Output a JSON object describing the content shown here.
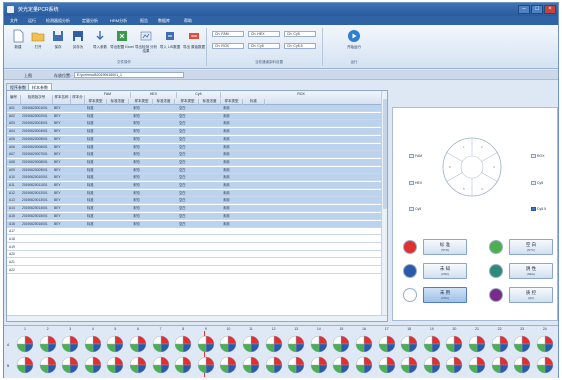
{
  "window": {
    "title": "荧光定量PCR系统"
  },
  "menu": [
    "文件",
    "运行",
    "检测器组分析",
    "定量分析",
    "HRM分析",
    "报告",
    "数据库",
    "帮助"
  ],
  "ribbon": {
    "buttons": [
      {
        "label": "新建",
        "icon": "new-file-icon"
      },
      {
        "label": "打开",
        "icon": "open-folder-icon"
      },
      {
        "label": "保存",
        "icon": "save-icon"
      },
      {
        "label": "另存为",
        "icon": "save-as-icon"
      },
      {
        "label": "导入参数",
        "icon": "import-params-icon"
      },
      {
        "label": "导出配置 Excel",
        "icon": "export-excel-icon"
      },
      {
        "label": "导出检测 分析结果",
        "icon": "export-results-icon"
      },
      {
        "label": "导入 LIS数据",
        "icon": "import-lis-icon"
      },
      {
        "label": "导出 原始数据",
        "icon": "export-raw-icon"
      },
      {
        "label": "开始运行",
        "icon": "run-icon"
      }
    ],
    "groups": [
      {
        "label": "文件操作"
      },
      {
        "label": "当前通道染料设置"
      },
      {
        "label": "运行"
      }
    ],
    "fields": [
      "Ch: FAM",
      "Ch: HEX",
      "Ch: Cy5",
      "Ch: ROX",
      "Ch: Cy5",
      "Ch: Cy5.5"
    ]
  },
  "pathbar": {
    "left_label": "上图",
    "path_label": "存放位置:",
    "path_value": "E:\\pcr\\result\\20190616001_1"
  },
  "tabs": [
    "程序参数",
    "样本参数"
  ],
  "table": {
    "headers_top": [
      "编号",
      "检测批次号",
      "样本名称",
      "样本分",
      "FAM",
      "HEX",
      "Cy5",
      "ROX"
    ],
    "headers_sub": [
      "样本类型",
      "标准浓度",
      "样本类型",
      "标准浓度",
      "样本类型",
      "标准浓度",
      "样本类型",
      "标准"
    ],
    "rows": [
      [
        "A01",
        "20190620001001",
        "BEY",
        "",
        "标准",
        "",
        "未知",
        "",
        "空白",
        "",
        "未用"
      ],
      [
        "A02",
        "20190620002001",
        "BEY",
        "",
        "标准",
        "",
        "未知",
        "",
        "空白",
        "",
        "未用"
      ],
      [
        "A03",
        "20190620003001",
        "BEY",
        "",
        "标准",
        "",
        "未知",
        "",
        "空白",
        "",
        "未用"
      ],
      [
        "A04",
        "20190620004001",
        "BEY",
        "",
        "标准",
        "",
        "未知",
        "",
        "空白",
        "",
        "未用"
      ],
      [
        "A05",
        "20190620005001",
        "BEY",
        "",
        "标准",
        "",
        "未知",
        "",
        "空白",
        "",
        "未用"
      ],
      [
        "A06",
        "20190620006001",
        "BEY",
        "",
        "标准",
        "",
        "未知",
        "",
        "空白",
        "",
        "未用"
      ],
      [
        "A07",
        "20190620007001",
        "BEY",
        "",
        "标准",
        "",
        "未知",
        "",
        "空白",
        "",
        "未用"
      ],
      [
        "A08",
        "20190620008001",
        "BEY",
        "",
        "标准",
        "",
        "未知",
        "",
        "空白",
        "",
        "未用"
      ],
      [
        "A09",
        "20190620009001",
        "BEY",
        "",
        "标准",
        "",
        "未知",
        "",
        "空白",
        "",
        "未用"
      ],
      [
        "A10",
        "20190620010001",
        "BEY",
        "",
        "标准",
        "",
        "未知",
        "",
        "空白",
        "",
        "未用"
      ],
      [
        "A11",
        "20190620011001",
        "BEY",
        "",
        "标准",
        "",
        "未知",
        "",
        "空白",
        "",
        "未用"
      ],
      [
        "A12",
        "20190620012001",
        "BEY",
        "",
        "标准",
        "",
        "未知",
        "",
        "空白",
        "",
        "未用"
      ],
      [
        "A13",
        "20190620013001",
        "BEY",
        "",
        "标准",
        "",
        "未知",
        "",
        "空白",
        "",
        "未用"
      ],
      [
        "A14",
        "20190620014001",
        "BEY",
        "",
        "标准",
        "",
        "未知",
        "",
        "空白",
        "",
        "未用"
      ],
      [
        "A15",
        "20190620015001",
        "BEY",
        "",
        "标准",
        "",
        "未知",
        "",
        "空白",
        "",
        "未用"
      ],
      [
        "A16",
        "20190620016001",
        "BEY",
        "",
        "标准",
        "",
        "未知",
        "",
        "空白",
        "",
        "未用"
      ],
      [
        "A17",
        "",
        "",
        "",
        "",
        "",
        "",
        "",
        "",
        "",
        ""
      ],
      [
        "A18",
        "",
        "",
        "",
        "",
        "",
        "",
        "",
        "",
        "",
        ""
      ],
      [
        "A19",
        "",
        "",
        "",
        "",
        "",
        "",
        "",
        "",
        "",
        ""
      ],
      [
        "A20",
        "",
        "",
        "",
        "",
        "",
        "",
        "",
        "",
        "",
        ""
      ],
      [
        "A21",
        "",
        "",
        "",
        "",
        "",
        "",
        "",
        "",
        "",
        ""
      ],
      [
        "A22",
        "",
        "",
        "",
        "",
        "",
        "",
        "",
        "",
        "",
        ""
      ]
    ]
  },
  "right_panel": {
    "channel_labels": [
      {
        "label": "FAM",
        "checked": false
      },
      {
        "label": "ROX",
        "checked": false
      },
      {
        "label": "HEX",
        "checked": false
      },
      {
        "label": "Cy5",
        "checked": false
      },
      {
        "label": "Cy5",
        "checked": false
      },
      {
        "label": "Cy5.5",
        "checked": true
      }
    ],
    "sector_numbers": [
      "1",
      "2",
      "3",
      "4",
      "5",
      "6"
    ],
    "sample_types": [
      {
        "main": "标 准",
        "sub": "(STD)",
        "color": "#e03030",
        "active": false
      },
      {
        "main": "空 白",
        "sub": "(NTC)",
        "color": "#4caf50",
        "active": false
      },
      {
        "main": "未 知",
        "sub": "(UNK)",
        "color": "#2b5aa8",
        "active": false
      },
      {
        "main": "阴 性",
        "sub": "(NEG)",
        "color": "#2e8b7a",
        "active": false
      },
      {
        "main": "未 用",
        "sub": "(UNU)",
        "color": "#ffffff",
        "active": true
      },
      {
        "main": "质 控",
        "sub": "(QC)",
        "color": "#7a2b8a",
        "active": false
      }
    ]
  },
  "tray": {
    "columns": [
      "1",
      "2",
      "3",
      "4",
      "5",
      "6",
      "7",
      "8",
      "9",
      "10",
      "11",
      "12",
      "13",
      "14",
      "15",
      "16",
      "17",
      "18",
      "19",
      "20",
      "21",
      "22",
      "23",
      "24"
    ],
    "rows": [
      "A",
      "B"
    ],
    "tube_colors": [
      "#e03030",
      "#2b5aa8",
      "#4caf50",
      "#ffffff"
    ]
  }
}
